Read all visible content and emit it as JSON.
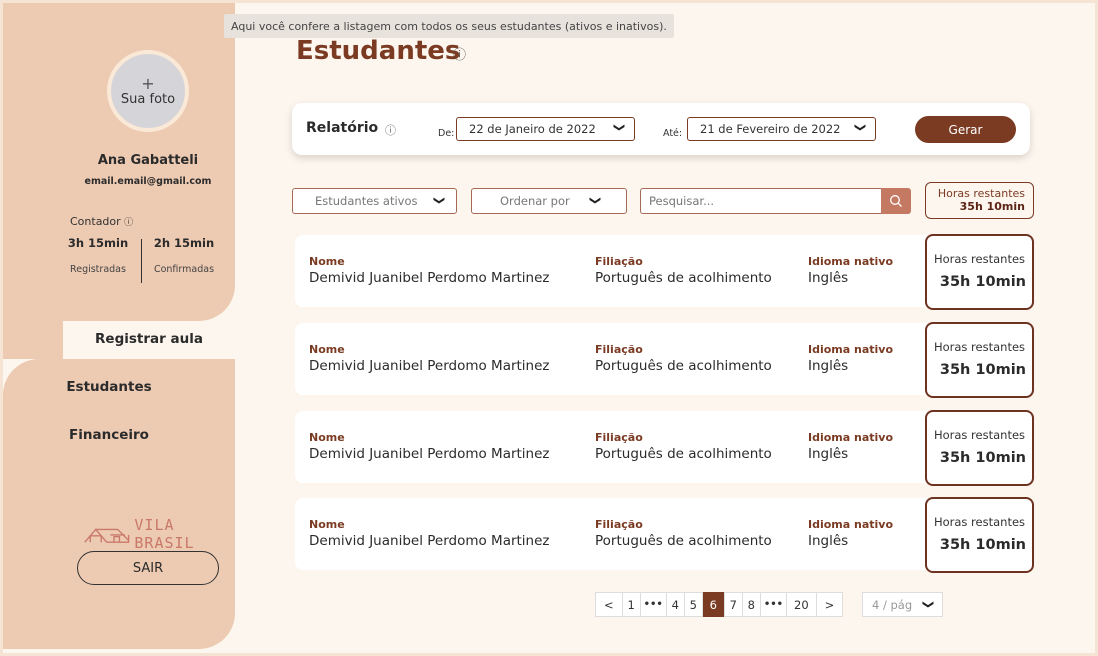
{
  "tooltip": "Aqui você confere a listagem com todos os seus estudantes (ativos e inativos).",
  "sidebar": {
    "avatar_plus": "+",
    "avatar_label": "Sua foto",
    "user_name": "Ana Gabatteli",
    "user_email": "email.email@gmail.com",
    "counter_label": "Contador",
    "info_icon": "ⓘ",
    "registered_value": "3h 15min",
    "registered_label": "Registradas",
    "confirmed_value": "2h 15min",
    "confirmed_label": "Confirmadas",
    "nav": [
      "Registrar aula",
      "Estudantes",
      "Financeiro"
    ],
    "logo_text": "VILA BRASIL",
    "logout_label": "SAIR"
  },
  "page": {
    "title": "Estudantes",
    "info_icon": "ⓘ"
  },
  "report": {
    "title": "Relatório",
    "info_icon": "ⓘ",
    "from_label": "De:",
    "from_value": "22 de Janeiro de 2022",
    "to_label": "Até:",
    "to_value": "21 de Fevereiro de 2022",
    "chevron": "❯",
    "generate_label": "Gerar"
  },
  "filters": {
    "status_value": "Estudantes ativos",
    "sort_placeholder": "Ordenar por",
    "search_placeholder": "Pesquisar...",
    "hours_label": "Horas restantes",
    "hours_value": "35h 10min"
  },
  "students": [
    {
      "name_label": "Nome",
      "name": "Demivid Juanibel Perdomo Martinez",
      "affiliation_label": "Filiação",
      "affiliation": "Português de acolhimento",
      "language_label": "Idioma nativo",
      "language": "Inglês",
      "hours_label": "Horas restantes",
      "hours": "35h 10min"
    },
    {
      "name_label": "Nome",
      "name": "Demivid Juanibel Perdomo Martinez",
      "affiliation_label": "Filiação",
      "affiliation": "Português de acolhimento",
      "language_label": "Idioma nativo",
      "language": "Inglês",
      "hours_label": "Horas restantes",
      "hours": "35h 10min"
    },
    {
      "name_label": "Nome",
      "name": "Demivid Juanibel Perdomo Martinez",
      "affiliation_label": "Filiação",
      "affiliation": "Português de acolhimento",
      "language_label": "Idioma nativo",
      "language": "Inglês",
      "hours_label": "Horas restantes",
      "hours": "35h 10min"
    },
    {
      "name_label": "Nome",
      "name": "Demivid Juanibel Perdomo Martinez",
      "affiliation_label": "Filiação",
      "affiliation": "Português de acolhimento",
      "language_label": "Idioma nativo",
      "language": "Inglês",
      "hours_label": "Horas restantes",
      "hours": "35h 10min"
    }
  ],
  "pagination": {
    "prev": "<",
    "next": ">",
    "pages": [
      "1",
      "•••",
      "4",
      "5",
      "6",
      "7",
      "8",
      "•••",
      "20"
    ],
    "active": "6",
    "page_size": "4 / pág"
  },
  "colors": {
    "brand": "#7a3b22",
    "sidebar": "#edcab2",
    "background": "#fdf6ee"
  }
}
